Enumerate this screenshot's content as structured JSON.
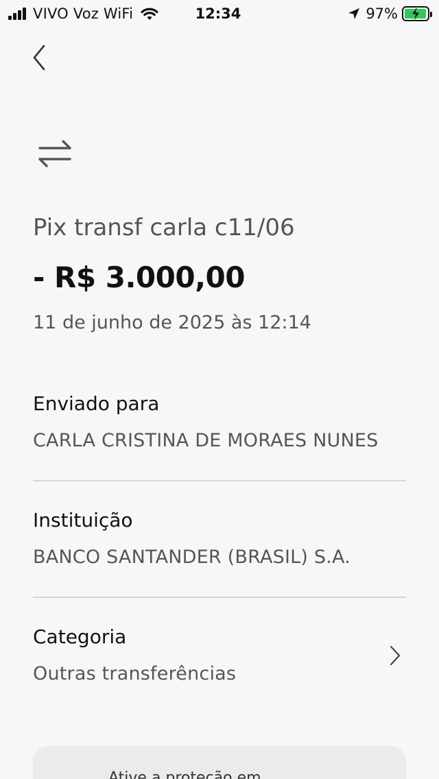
{
  "status_bar": {
    "carrier": "VIVO Voz WiFi",
    "time": "12:34",
    "battery_percent": "97%",
    "battery_level": 0.97,
    "battery_color": "#34c759"
  },
  "nav": {
    "back_icon": "chevron-left-icon"
  },
  "transaction": {
    "icon": "transfer-arrows-icon",
    "title": "Pix transf carla c11/06",
    "amount": "- R$ 3.000,00",
    "date": "11 de junho de 2025 às 12:14"
  },
  "details": {
    "sent_to": {
      "label": "Enviado para",
      "value": "CARLA CRISTINA DE MORAES NUNES"
    },
    "institution": {
      "label": "Instituição",
      "value": "BANCO SANTANDER (BRASIL) S.A."
    },
    "category": {
      "label": "Categoria",
      "value": "Outras transferências",
      "icon": "chevron-right-icon"
    }
  },
  "protection_card": {
    "text": "Ative a proteção em"
  }
}
